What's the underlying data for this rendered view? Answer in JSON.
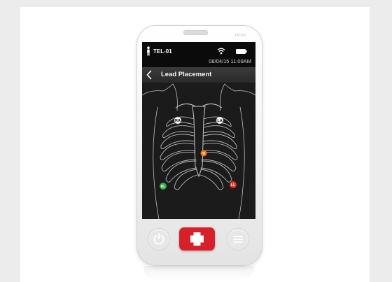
{
  "device": {
    "model_label": "TM-60"
  },
  "status_bar": {
    "device_id": "TEL-01",
    "datetime": "08/04/15 11:09AM"
  },
  "header": {
    "title": "Lead Placement"
  },
  "leads": [
    {
      "label": "RA",
      "color": "#ffffff"
    },
    {
      "label": "LA",
      "color": "#ffffff"
    },
    {
      "label": "V",
      "color": "#f07a1d"
    },
    {
      "label": "RL",
      "color": "#2fae43"
    },
    {
      "label": "LL",
      "color": "#e0342a"
    }
  ],
  "icons": {
    "patient": "person-icon",
    "wifi": "wifi-icon",
    "battery": "battery-icon",
    "back": "chevron-left-icon",
    "power": "power-icon",
    "emergency": "medical-cross-icon",
    "menu": "menu-icon"
  },
  "colors": {
    "screen_bg": "#1b1b1b",
    "emergency": "#d8202a",
    "device_body": "#f3f3f3"
  }
}
